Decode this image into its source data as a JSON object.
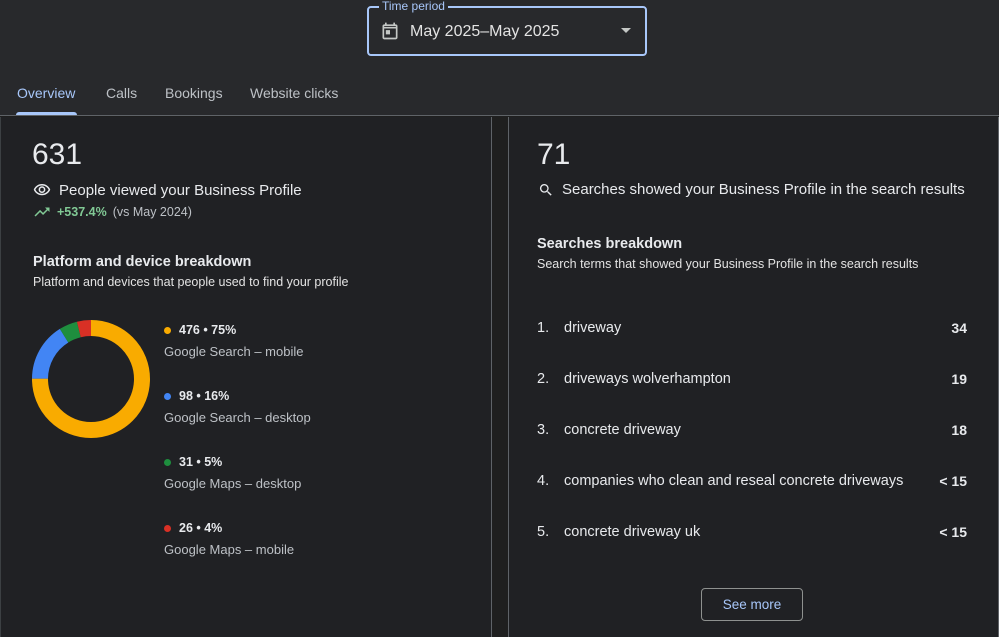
{
  "time_period": {
    "label": "Time period",
    "value": "May 2025–May 2025"
  },
  "tabs": [
    {
      "label": "Overview",
      "active": true
    },
    {
      "label": "Calls",
      "active": false
    },
    {
      "label": "Bookings",
      "active": false
    },
    {
      "label": "Website clicks",
      "active": false
    }
  ],
  "profile_views": {
    "count": "631",
    "label": "People viewed your Business Profile",
    "delta": "+537.4%",
    "compare": "(vs May 2024)"
  },
  "platform_breakdown": {
    "title": "Platform and device breakdown",
    "subtitle": "Platform and devices that people used to find your profile",
    "items": [
      {
        "value": "476 • 75%",
        "label": "Google Search – mobile",
        "color": "#f9ab00",
        "fraction": 0.75
      },
      {
        "value": "98 • 16%",
        "label": "Google Search – desktop",
        "color": "#4285f4",
        "fraction": 0.16
      },
      {
        "value": "31 • 5%",
        "label": "Google Maps – desktop",
        "color": "#1e8e3e",
        "fraction": 0.05
      },
      {
        "value": "26 • 4%",
        "label": "Google Maps – mobile",
        "color": "#d93025",
        "fraction": 0.04
      }
    ]
  },
  "searches": {
    "count": "71",
    "label": "Searches showed your Business Profile in the search results",
    "title": "Searches breakdown",
    "subtitle": "Search terms that showed your Business Profile in the search results",
    "items": [
      {
        "rank": "1.",
        "term": "driveway",
        "count": "34"
      },
      {
        "rank": "2.",
        "term": "driveways wolverhampton",
        "count": "19"
      },
      {
        "rank": "3.",
        "term": "concrete driveway",
        "count": "18"
      },
      {
        "rank": "4.",
        "term": "companies who clean and reseal concrete driveways",
        "count": "< 15"
      },
      {
        "rank": "5.",
        "term": "concrete driveway uk",
        "count": "< 15"
      }
    ],
    "see_more": "See more"
  }
}
